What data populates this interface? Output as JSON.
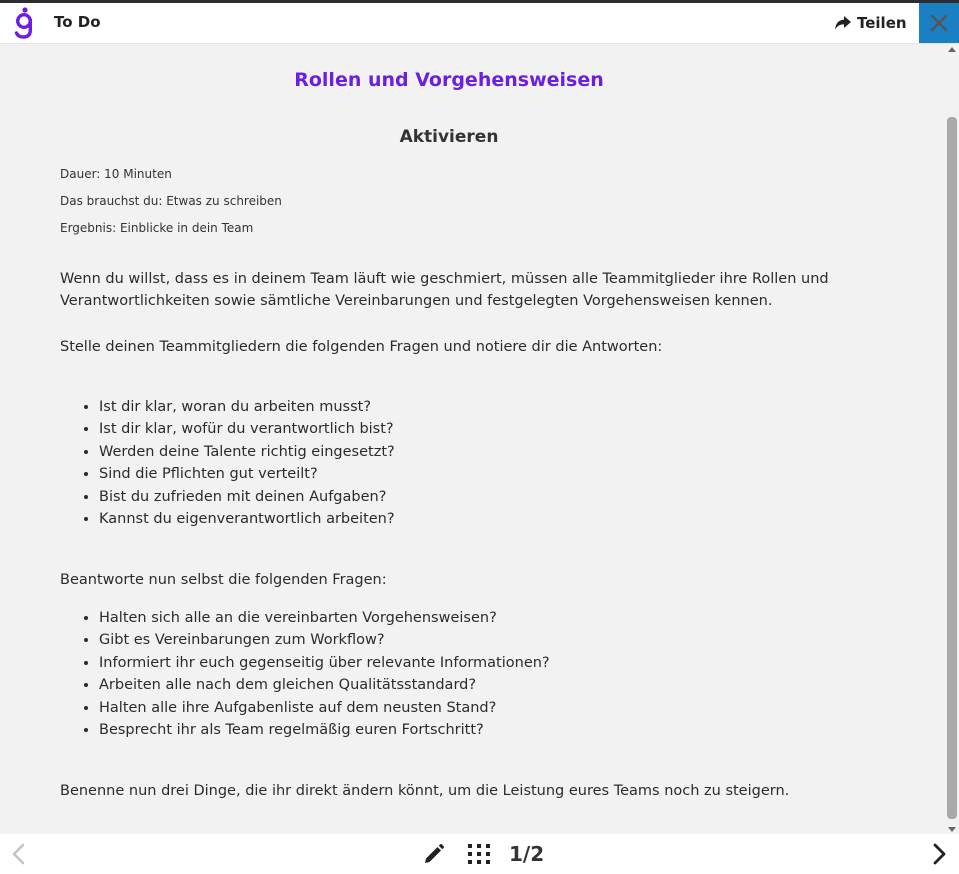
{
  "header": {
    "logo_icon": "brand-logo-g",
    "title": "To Do",
    "share_label": "Teilen",
    "share_icon": "share-arrow-icon",
    "close_icon": "close-icon"
  },
  "content": {
    "page_heading": "Rollen und Vorgehensweisen",
    "section_heading": "Aktivieren",
    "meta": [
      "Dauer: 10 Minuten",
      "Das brauchst du: Etwas zu schreiben",
      "Ergebnis: Einblicke in dein Team"
    ],
    "intro": "Wenn du willst, dass es in deinem Team läuft wie geschmiert, müssen alle Teammitglieder ihre Rollen und Verantwortlichkeiten sowie sämtliche Vereinbarungen und festgelegten Vorgehensweisen kennen.",
    "ask_intro": "Stelle deinen Teammitgliedern die folgenden Fragen und notiere dir die Antworten:",
    "ask_questions": [
      "Ist dir klar, woran du arbeiten musst?",
      "Ist dir klar, wofür du verantwortlich bist?",
      "Werden deine Talente richtig eingesetzt?",
      "Sind die Pflichten gut verteilt?",
      "Bist du zufrieden mit deinen Aufgaben?",
      "Kannst du eigenverantwortlich arbeiten?"
    ],
    "answer_intro": "Beantworte nun selbst die folgenden Fragen:",
    "answer_questions": [
      "Halten sich alle an die vereinbarten Vorgehensweisen?",
      "Gibt es Vereinbarungen zum Workflow?",
      "Informiert ihr euch gegenseitig über relevante Informationen?",
      "Arbeiten alle nach dem gleichen Qualitätsstandard?",
      "Halten alle ihre Aufgabenliste auf dem neusten Stand?",
      "Besprecht ihr als Team regelmäßig euren Fortschritt?"
    ],
    "closing": "Benenne nun drei Dinge, die ihr direkt ändern könnt, um die Leistung eures Teams noch zu steigern."
  },
  "footer": {
    "page_indicator": "1/2",
    "prev_icon": "chevron-left-icon",
    "next_icon": "chevron-right-icon",
    "edit_icon": "pencil-icon",
    "grid_icon": "grid-icon"
  },
  "colors": {
    "accent": "#6c1fe0",
    "close_bg": "#1b7fc4",
    "background": "#f2f2f2"
  }
}
